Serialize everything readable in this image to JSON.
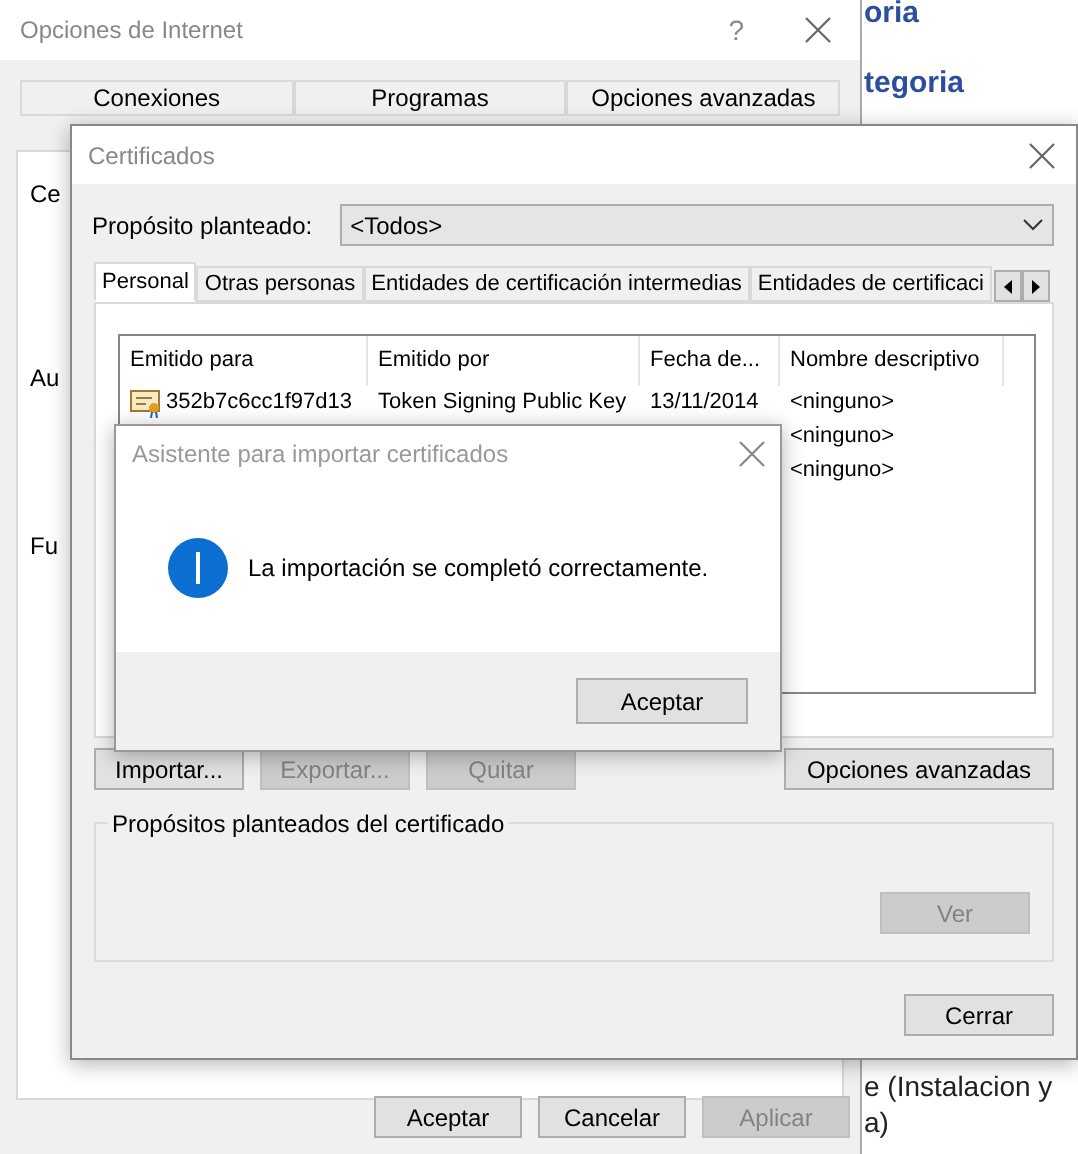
{
  "background_page": {
    "links": [
      "oria",
      "tegoria"
    ],
    "footer_text": [
      "e (Instalacion y",
      "a)"
    ]
  },
  "internet_options": {
    "title": "Opciones de Internet",
    "help": "?",
    "tabs": [
      {
        "label": "Conexiones",
        "selected": false
      },
      {
        "label": "Programas",
        "selected": false
      },
      {
        "label": "Opciones avanzadas",
        "selected": false
      }
    ],
    "section_labels": [
      "Ce",
      "Au",
      "Fu"
    ],
    "buttons": [
      {
        "label": "Aceptar",
        "disabled": false
      },
      {
        "label": "Cancelar",
        "disabled": false
      },
      {
        "label": "Aplicar",
        "disabled": true
      }
    ]
  },
  "certificates": {
    "title": "Certificados",
    "purpose_label": "Propósito planteado:",
    "purpose_value": "<Todos>",
    "tabs": [
      {
        "label": "Personal",
        "selected": true
      },
      {
        "label": "Otras personas",
        "selected": false
      },
      {
        "label": "Entidades de certificación intermedias",
        "selected": false
      },
      {
        "label": "Entidades de certificaci",
        "selected": false
      }
    ],
    "columns": [
      "Emitido para",
      "Emitido por",
      "Fecha de...",
      "Nombre descriptivo"
    ],
    "rows": [
      {
        "cells": [
          "352b7c6cc1f97d13",
          "Token Signing Public Key",
          "13/11/2014",
          "<ninguno>"
        ],
        "icon": true
      },
      {
        "cells": [
          "",
          "",
          "",
          "<ninguno>"
        ],
        "icon": false
      },
      {
        "cells": [
          "",
          "",
          "",
          "<ninguno>"
        ],
        "icon": false
      }
    ],
    "buttons": [
      {
        "label": "Importar...",
        "disabled": false
      },
      {
        "label": "Exportar...",
        "disabled": true
      },
      {
        "label": "Quitar",
        "disabled": true
      }
    ],
    "advanced_button": {
      "label": "Opciones avanzadas",
      "disabled": false
    },
    "purposes_group": {
      "title": "Propósitos planteados del certificado",
      "button": {
        "label": "Ver",
        "disabled": true
      }
    },
    "close_button": {
      "label": "Cerrar",
      "disabled": false
    }
  },
  "import_wizard": {
    "title": "Asistente para importar certificados",
    "message": "La importación se completó correctamente.",
    "button": {
      "label": "Aceptar",
      "disabled": false
    }
  }
}
